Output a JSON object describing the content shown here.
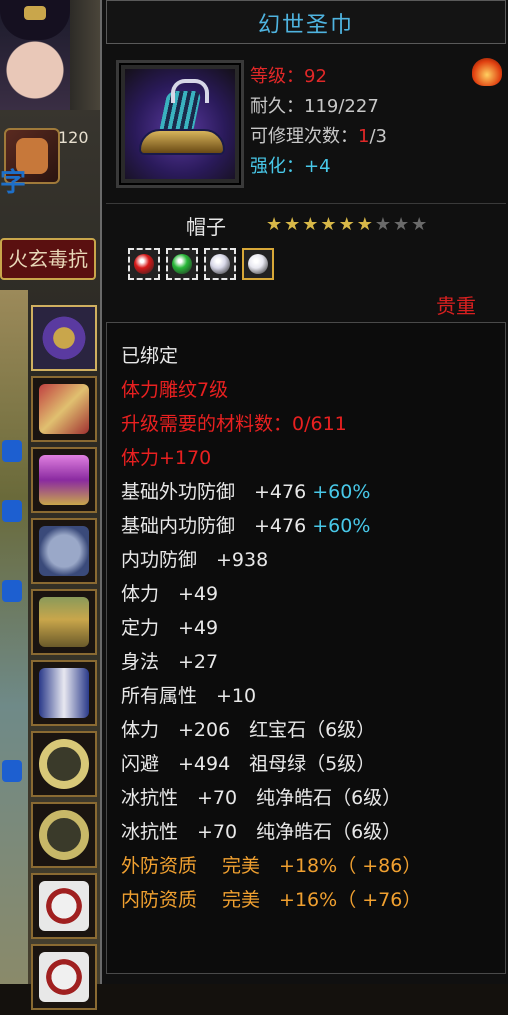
{
  "side": {
    "level_number": "120",
    "label_fragment": "字",
    "resist_label": "火玄毒抗"
  },
  "item": {
    "name": "幻世圣巾",
    "level_label": "等级：",
    "level_value": "92",
    "durability_label": "耐久：",
    "durability_value": "119/227",
    "repair_label": "可修理次数：",
    "repair_used": "1",
    "repair_total": "/3",
    "enhance_label": "强化：",
    "enhance_value": "+4",
    "type": "帽子",
    "stars_filled": 6,
    "stars_total": 9,
    "gem_colors": [
      "#d81818",
      "#28b838",
      "#d8d8e8",
      "#e8e8f0"
    ],
    "quality": "贵重"
  },
  "attributes": [
    {
      "text": "已绑定",
      "extra": "",
      "color": "white"
    },
    {
      "text": "体力雕纹7级",
      "extra": "",
      "color": "red"
    },
    {
      "text": "升级需要的材料数：0/611",
      "extra": "",
      "color": "red"
    },
    {
      "text": "体力+170",
      "extra": "",
      "color": "red"
    },
    {
      "text": "基础外功防御　+476",
      "extra": "+60%",
      "color": "yellow"
    },
    {
      "text": "基础内功防御　+476",
      "extra": "+60%",
      "color": "yellow"
    },
    {
      "text": "内功防御　+938",
      "extra": "",
      "color": "yellow"
    },
    {
      "text": "体力　+49",
      "extra": "",
      "color": "yellow"
    },
    {
      "text": "定力　+49",
      "extra": "",
      "color": "yellow"
    },
    {
      "text": "身法　+27",
      "extra": "",
      "color": "yellow"
    },
    {
      "text": "所有属性　+10",
      "extra": "",
      "color": "yellow"
    },
    {
      "text": "体力　+206　红宝石（6级）",
      "extra": "",
      "color": "white-yellow"
    },
    {
      "text": "闪避　+494　祖母绿（5级）",
      "extra": "",
      "color": "white-yellow"
    },
    {
      "text": "冰抗性　+70　纯净皓石（6级）",
      "extra": "",
      "color": "white-yellow"
    },
    {
      "text": "冰抗性　+70　纯净皓石（6级）",
      "extra": "",
      "color": "white-yellow"
    },
    {
      "text": "外防资质　 完美　+18%（ +86）",
      "extra": "",
      "color": "orange"
    },
    {
      "text": "内防资质　 完美　+16%（ +76）",
      "extra": "",
      "color": "orange"
    }
  ]
}
